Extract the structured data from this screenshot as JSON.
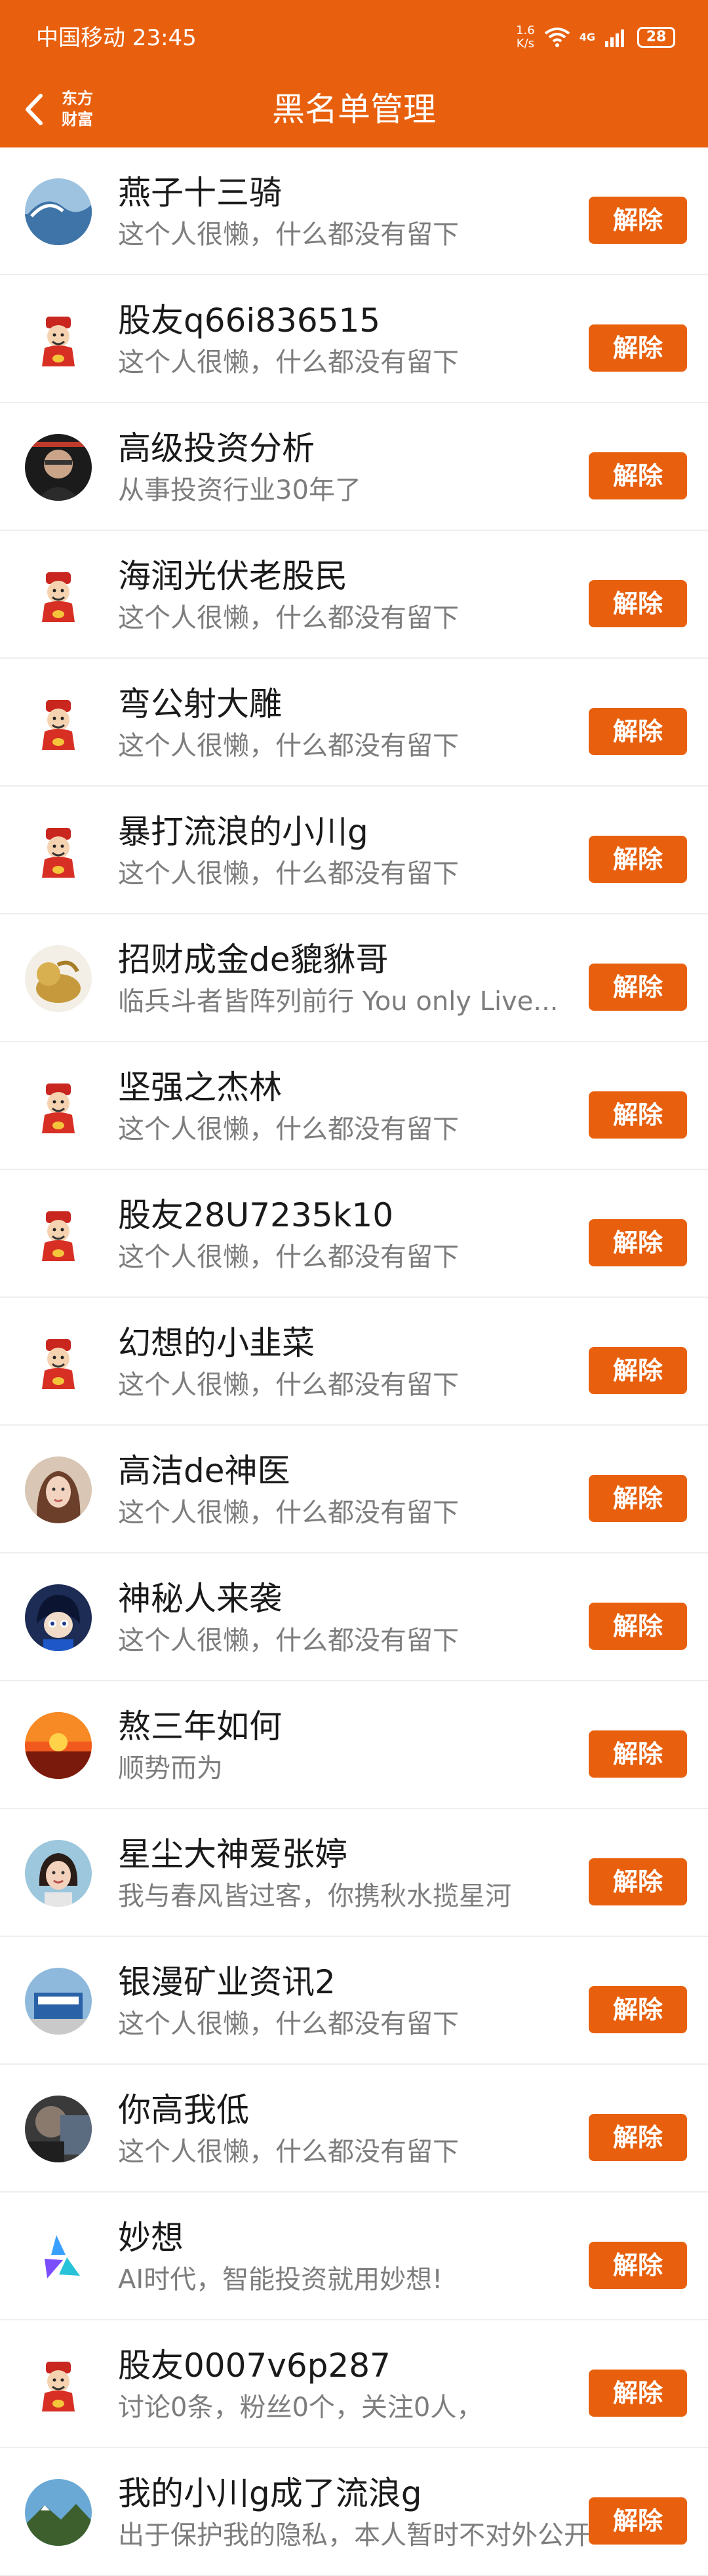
{
  "status": {
    "carrier_time": "中国移动 23:45",
    "net_speed_value": "1.6",
    "net_speed_unit": "K/s",
    "battery": "28",
    "network": "4G"
  },
  "header": {
    "title": "黑名单管理",
    "logo_line1": "东方",
    "logo_line2": "财富"
  },
  "colors": {
    "brand": "#e8600e",
    "name_text": "#1a1a1a",
    "desc_text": "#7d7d7d"
  },
  "items": [
    {
      "name": "燕子十三骑",
      "desc": "这个人很懒，什么都没有留下",
      "button": "解除",
      "avatar": "wave"
    },
    {
      "name": "股友q66i836515",
      "desc": "这个人很懒，什么都没有留下",
      "button": "解除",
      "avatar": "caishen"
    },
    {
      "name": "高级投资分析",
      "desc": "从事投资行业30年了",
      "button": "解除",
      "avatar": "man-dark"
    },
    {
      "name": "海润光伏老股民",
      "desc": "这个人很懒，什么都没有留下",
      "button": "解除",
      "avatar": "caishen"
    },
    {
      "name": "弯公射大雕",
      "desc": "这个人很懒，什么都没有留下",
      "button": "解除",
      "avatar": "caishen"
    },
    {
      "name": "暴打流浪的小川g",
      "desc": "这个人很懒，什么都没有留下",
      "button": "解除",
      "avatar": "caishen"
    },
    {
      "name": "招财成金de貔貅哥",
      "desc": "临兵斗者皆阵列前行 You only Live...",
      "button": "解除",
      "avatar": "golden-pixiu"
    },
    {
      "name": "坚强之杰林",
      "desc": "这个人很懒，什么都没有留下",
      "button": "解除",
      "avatar": "caishen"
    },
    {
      "name": "股友28U7235k10",
      "desc": "这个人很懒，什么都没有留下",
      "button": "解除",
      "avatar": "caishen"
    },
    {
      "name": "幻想的小韭菜",
      "desc": "这个人很懒，什么都没有留下",
      "button": "解除",
      "avatar": "caishen"
    },
    {
      "name": "高洁de神医",
      "desc": "这个人很懒，什么都没有留下",
      "button": "解除",
      "avatar": "woman"
    },
    {
      "name": "神秘人来袭",
      "desc": "这个人很懒，什么都没有留下",
      "button": "解除",
      "avatar": "anime"
    },
    {
      "name": "熬三年如何",
      "desc": "顺势而为",
      "button": "解除",
      "avatar": "sunset"
    },
    {
      "name": "星尘大神爱张婷",
      "desc": "我与春风皆过客，你携秋水揽星河",
      "button": "解除",
      "avatar": "woman-2"
    },
    {
      "name": "银漫矿业资讯2",
      "desc": "这个人很懒，什么都没有留下",
      "button": "解除",
      "avatar": "building"
    },
    {
      "name": "你高我低",
      "desc": "这个人很懒，什么都没有留下",
      "button": "解除",
      "avatar": "dark-photo"
    },
    {
      "name": "妙想",
      "desc": "AI时代，智能投资就用妙想!",
      "button": "解除",
      "avatar": "ai-logo"
    },
    {
      "name": "股友0007v6p287",
      "desc": "讨论0条，粉丝0个，关注0人，",
      "button": "解除",
      "avatar": "caishen"
    },
    {
      "name": "我的小川g成了流浪g",
      "desc": "出于保护我的隐私，本人暂时不对外公开",
      "button": "解除",
      "avatar": "landscape"
    }
  ]
}
